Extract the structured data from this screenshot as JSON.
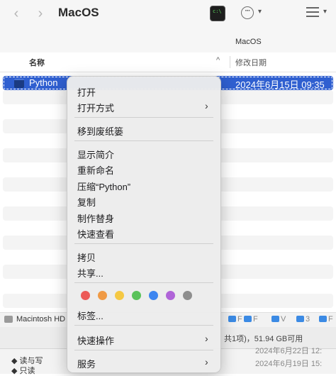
{
  "toolbar": {
    "title": "MacOS",
    "back_icon": "chevron-left-icon",
    "forward_icon": "chevron-right-icon",
    "terminal_icon_text": "c:\\",
    "more_icon": "ellipsis-circle-icon",
    "view_icon": "list-view-icon"
  },
  "pathbar": {
    "title": "MacOS"
  },
  "columns": {
    "name": "名称",
    "date": "修改日期"
  },
  "selected_row": {
    "name": "Python",
    "date": "2024年6月15日 09:35"
  },
  "bottom_path": {
    "disk": "Macintosh HD",
    "crumbs": [
      "F",
      "F",
      "V",
      "3",
      "F"
    ]
  },
  "status": {
    "text": "共1项)，51.94 GB可用"
  },
  "info_panel": {
    "items": [
      "读与写",
      "只读"
    ],
    "dates": [
      "2024年6月22日 12:",
      "2024年6月19日 15:"
    ]
  },
  "context_menu": {
    "open": "打开",
    "open_with": "打开方式",
    "move_to_trash": "移到废纸篓",
    "get_info": "显示简介",
    "rename": "重新命名",
    "compress": "压缩“Python”",
    "duplicate": "复制",
    "make_alias": "制作替身",
    "quick_look": "快速查看",
    "copy": "拷贝",
    "share": "共享...",
    "tags": "标签...",
    "quick_actions": "快速操作",
    "services": "服务",
    "tag_colors": [
      "#ec5a57",
      "#f09a45",
      "#f5c843",
      "#5ac25a",
      "#3d85f0",
      "#b064d8",
      "#8e8e8e"
    ]
  }
}
